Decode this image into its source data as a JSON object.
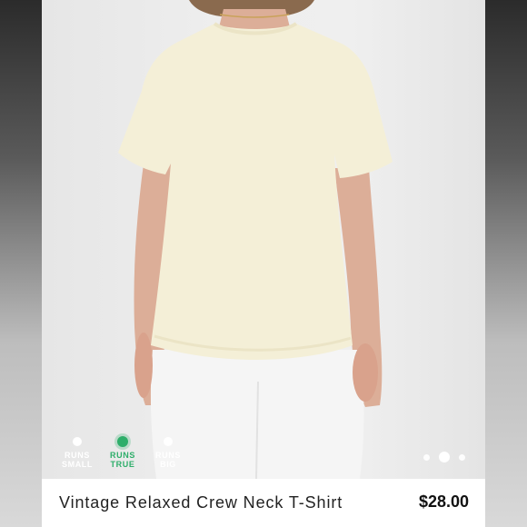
{
  "listing": {
    "title": "Vintage Relaxed Crew Neck T-Shirt",
    "price": "$28.00"
  },
  "fit": {
    "options": [
      {
        "label": "RUNS\nSMALL",
        "selected": false
      },
      {
        "label": "RUNS\nTRUE",
        "selected": true
      },
      {
        "label": "RUNS\nBIG",
        "selected": false
      }
    ],
    "accent_color": "#2eae6a"
  },
  "carousel": {
    "total_images": 3,
    "current_index": 2
  },
  "photo": {
    "subject": "product-photo",
    "shirt_color": "#f4efd7",
    "pants_color": "#f5f5f5",
    "skin_color": "#dcae98"
  }
}
